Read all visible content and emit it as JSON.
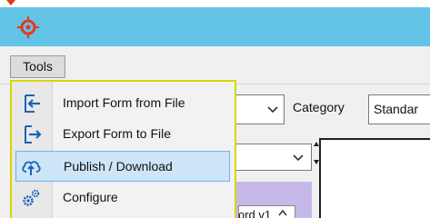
{
  "menu": {
    "tools_label": "Tools",
    "items": [
      {
        "label": "Import Form from File",
        "icon": "import-icon"
      },
      {
        "label": "Export Form to File",
        "icon": "export-icon"
      },
      {
        "label": "Publish / Download",
        "icon": "cloud-upload-icon",
        "highlighted": true
      },
      {
        "label": "Configure",
        "icon": "gears-icon"
      }
    ]
  },
  "toolbar": {
    "category_label": "Category",
    "category_value": "Standar"
  },
  "panel": {
    "tab_text": "ord v1"
  },
  "colors": {
    "titlebar": "#62c3e6",
    "menu_border": "#d7d700",
    "highlight_fill": "#cde5f7",
    "highlight_border": "#75b0e5",
    "icon_blue": "#1a63b8",
    "app_icon": "#e53a1a",
    "purple_panel": "#c6b9e9"
  }
}
